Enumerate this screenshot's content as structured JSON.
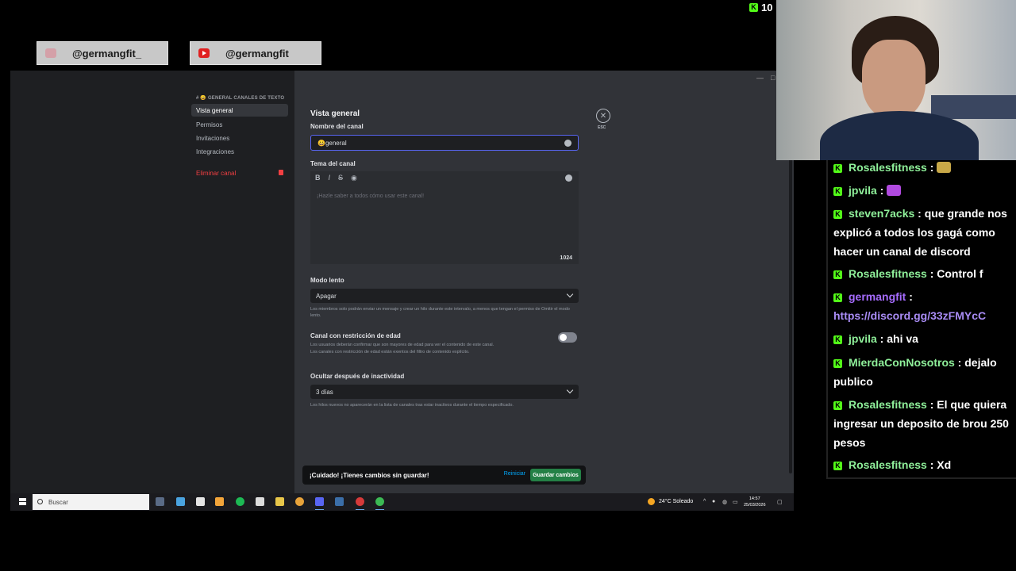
{
  "overlay": {
    "instagram_handle": "@germangfit_",
    "youtube_handle": "@germangfit",
    "viewer_count": "10"
  },
  "settings": {
    "sidebar": {
      "category": "# 😀 GENERAL  CANALES DE TEXTO",
      "items": [
        {
          "label": "Vista general"
        },
        {
          "label": "Permisos"
        },
        {
          "label": "Invitaciones"
        },
        {
          "label": "Integraciones"
        }
      ],
      "delete_label": "Eliminar canal"
    },
    "title": "Vista general",
    "close_label": "ESC",
    "channel_name_label": "Nombre del canal",
    "channel_name_value": "😀general",
    "topic_label": "Tema del canal",
    "topic_toolbar": [
      "B",
      "I",
      "S",
      "◉"
    ],
    "topic_placeholder": "¡Hazle saber a todos cómo usar este canal!",
    "topic_counter": "1024",
    "slowmode_label": "Modo lento",
    "slowmode_value": "Apagar",
    "slowmode_help": "Los miembros solo podrán enviar un mensaje y crear un hilo durante este intervalo, a menos que tengan el permiso de Omitir el modo lento.",
    "age_label": "Canal con restricción de edad",
    "age_help_1": "Los usuarios deberán confirmar que son mayores de edad para ver el contenido de este canal.",
    "age_help_2": "Los canales con restricción de edad están exentos del filtro de contenido explícito.",
    "age_restricted": false,
    "inactivity_label": "Ocultar después de inactividad",
    "inactivity_value": "3 días",
    "inactivity_help": "Los hilos nuevos no aparecerán en la lista de canales tras estar inactivos durante el tiempo especificado.",
    "unsaved_warning": "¡Cuidado! ¡Tienes cambios sin guardar!",
    "reset_label": "Reiniciar",
    "save_label": "Guardar cambios"
  },
  "taskbar": {
    "search_placeholder": "Buscar",
    "weather": "24°C  Soleado",
    "time": "14:57",
    "date": "25/03/2026"
  },
  "chat": {
    "messages": [
      {
        "user": "Rosalesfitness",
        "text": " : "
      },
      {
        "user": "jpvila",
        "text": " : "
      },
      {
        "user": "steven7acks",
        "text": " : que grande nos explicó a todos los gagá como hacer un canal de discord"
      },
      {
        "user": "Rosalesfitness",
        "text": " : Control f"
      },
      {
        "user": "germangfit",
        "text": " : ",
        "link": "https://discord.gg/33zFMYcC"
      },
      {
        "user": "jpvila",
        "text": " : ahi va"
      },
      {
        "user": "MierdaConNosotros",
        "text": " : dejalo publico"
      },
      {
        "user": "Rosalesfitness",
        "text": " : El que quiera ingresar un deposito de brou 250 pesos"
      },
      {
        "user": "Rosalesfitness",
        "text": " : Xd"
      }
    ]
  },
  "colors": {
    "accent": "#5865f2",
    "danger": "#f23f42",
    "save": "#248046",
    "kick": "#53fc18"
  }
}
